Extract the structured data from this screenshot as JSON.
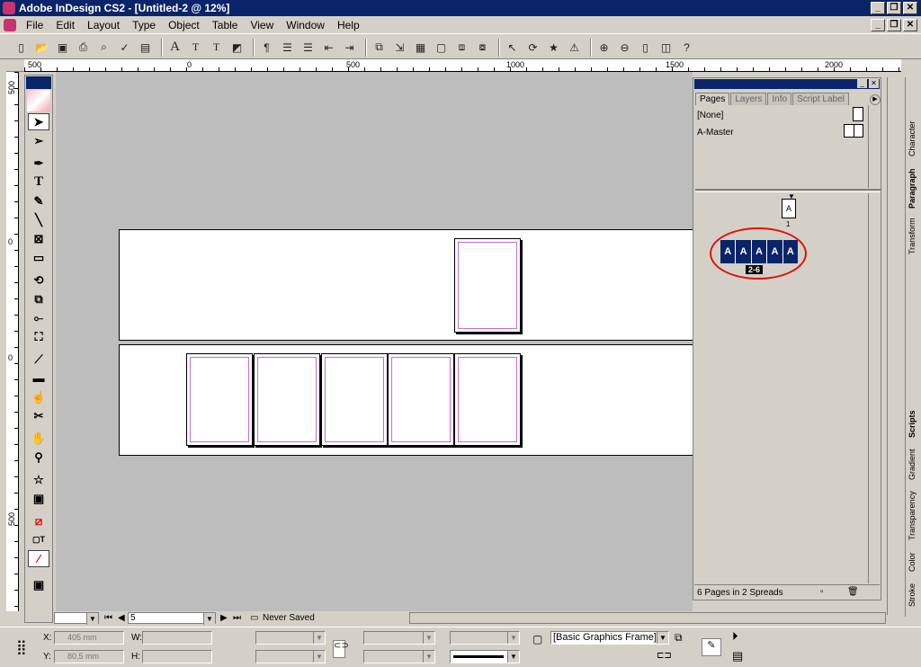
{
  "app": {
    "title": "Adobe InDesign CS2 - [Untitled-2 @ 12%]"
  },
  "menu": [
    "File",
    "Edit",
    "Layout",
    "Type",
    "Object",
    "Table",
    "View",
    "Window",
    "Help"
  ],
  "ruler": {
    "h_labels": [
      "500",
      "0",
      "500",
      "1000",
      "1500",
      "2000"
    ],
    "v_labels": [
      "500",
      "0",
      "0",
      "500"
    ]
  },
  "pages_panel": {
    "tabs": [
      "Pages",
      "Layers",
      "Info",
      "Script Label"
    ],
    "masters": [
      "[None]",
      "A-Master"
    ],
    "page1_letter": "A",
    "page1_number": "1",
    "spread_letters": [
      "A",
      "A",
      "A",
      "A",
      "A"
    ],
    "spread_label": "2-6",
    "footer": "6 Pages in 2 Spreads"
  },
  "side_tabs": {
    "top": [
      "Character",
      "Paragraph",
      "Transform"
    ],
    "bottom": [
      "Scripts",
      "Gradient",
      "Transparency",
      "Color",
      "Stroke"
    ]
  },
  "status": {
    "page_number": "5",
    "saved_state": "Never Saved"
  },
  "control": {
    "x_label": "X:",
    "x_value": "405 mm",
    "y_label": "Y:",
    "y_value": "80,5 mm",
    "w_label": "W:",
    "h_label": "H:",
    "object_style": "[Basic Graphics Frame]+"
  }
}
